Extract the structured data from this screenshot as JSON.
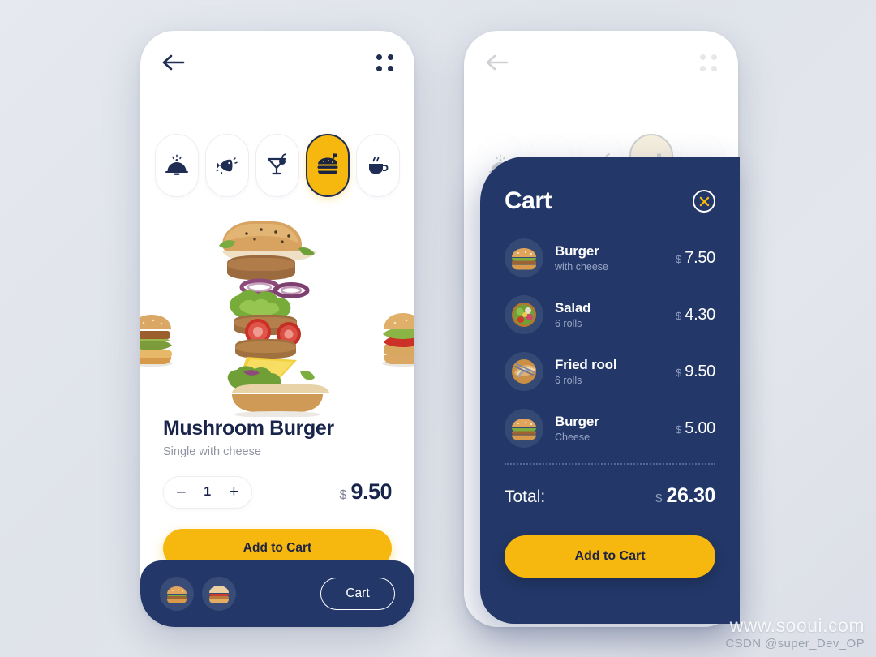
{
  "app": {
    "background_color": "#e2e5ec",
    "accent_yellow": "#f6b80f",
    "navy": "#233869"
  },
  "screen_detail": {
    "topbar": {
      "back_icon": "arrow-left-icon",
      "menu_icon": "grid-dots-icon"
    },
    "categories": [
      {
        "id": "dish",
        "icon": "cloche-dish-icon",
        "selected": false
      },
      {
        "id": "fish",
        "icon": "fish-icon",
        "selected": false
      },
      {
        "id": "drink",
        "icon": "cocktail-glass-icon",
        "selected": false
      },
      {
        "id": "burger",
        "icon": "burger-icon",
        "selected": true
      },
      {
        "id": "coffee",
        "icon": "coffee-cup-icon",
        "selected": false
      }
    ],
    "hero": {
      "main_image": "deconstructed-burger-photo",
      "left_image": "burger-side-photo",
      "right_image": "burger-side-photo"
    },
    "product": {
      "title": "Mushroom Burger",
      "subtitle": "Single with cheese",
      "quantity": "1",
      "minus_label": "–",
      "plus_label": "+",
      "currency": "$",
      "price": "9.50",
      "add_to_cart_label": "Add to Cart"
    },
    "bottombar": {
      "thumbs": [
        "burger-thumb-1",
        "burger-thumb-2"
      ],
      "cart_button_label": "Cart"
    }
  },
  "screen_cart": {
    "title": "Cart",
    "close_icon": "close-x-icon",
    "items": [
      {
        "image": "burger-thumb",
        "name": "Burger",
        "desc": "with cheese",
        "currency": "$",
        "price": "7.50"
      },
      {
        "image": "salad-bowl-thumb",
        "name": "Salad",
        "desc": "6 rolls",
        "currency": "$",
        "price": "4.30"
      },
      {
        "image": "fried-roll-thumb",
        "name": "Fried rool",
        "desc": "6 rolls",
        "currency": "$",
        "price": "9.50"
      },
      {
        "image": "burger-thumb",
        "name": "Burger",
        "desc": "Cheese",
        "currency": "$",
        "price": "5.00"
      }
    ],
    "total_label": "Total:",
    "total_currency": "$",
    "total_value": "26.30",
    "add_to_cart_label": "Add to Cart"
  },
  "watermark": {
    "site": "www.sooui.com",
    "credit": "CSDN @super_Dev_OP"
  }
}
